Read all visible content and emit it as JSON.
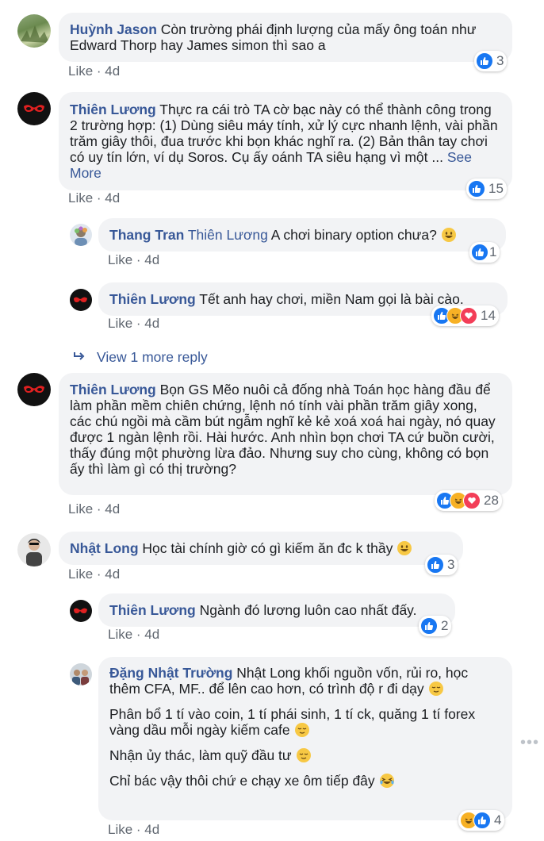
{
  "comments": [
    {
      "name": "Huỳnh Jason",
      "text": "Còn trường phái định lượng của mấy ông toán như Edward Thorp hay James simon thì sao a",
      "like": "Like",
      "time": "4d",
      "count": "3"
    },
    {
      "name": "Thiên Lương",
      "text": "Thực ra cái trò TA cờ bạc này có thể thành công trong 2 trường hợp: (1) Dùng siêu máy tính, xử lý cực nhanh lệnh, vài phần trăm giây thôi, đua trước khi bọn khác nghĩ ra. (2) Bản thân tay chơi có uy tín lớn, ví dụ Soros. Cụ ấy oánh TA siêu hạng vì một ...",
      "see_more": "See More",
      "like": "Like",
      "time": "4d",
      "count": "15"
    },
    {
      "name": "Thang Tran",
      "tag": "Thiên Lương",
      "text": "A chơi binary option chưa?",
      "like": "Like",
      "time": "4d",
      "count": "1"
    },
    {
      "name": "Thiên Lương",
      "text": "Tết anh hay chơi, miền Nam gọi là bài cào.",
      "like": "Like",
      "time": "4d",
      "count": "14"
    },
    {
      "view_more": "View 1 more reply"
    },
    {
      "name": "Thiên Lương",
      "text": "Bọn GS Mẽo nuôi cả đống nhà Toán học hàng đầu để làm phần mềm chiên chứng, lệnh nó tính vài phần trăm giây xong, các chú ngồi mà cầm bút ngẫm nghĩ kẻ kẻ xoá xoá hai ngày, nó quay được 1 ngàn lệnh rồi. Hài hước. Anh nhìn bọn chơi TA cứ buồn cười, thấy đúng một phường lừa đảo. Nhưng suy cho cùng, không có bọn ấy thì làm gì có thị trường?",
      "like": "Like",
      "time": "4d",
      "count": "28"
    },
    {
      "name": "Nhật Long",
      "text": "Học tài chính giờ có gì kiếm ăn đc k thầy",
      "like": "Like",
      "time": "4d",
      "count": "3"
    },
    {
      "name": "Thiên Lương",
      "text": "Ngành đó lương luôn cao nhất đấy.",
      "like": "Like",
      "time": "4d",
      "count": "2"
    },
    {
      "name": "Đặng Nhật Trường",
      "p1": "Nhật Long khối nguồn vốn, rủi ro, học thêm CFA, MF.. để lên cao hơn, có trình độ r đi dạy",
      "p2": "Phân bổ 1 tí vào coin, 1 tí phái sinh, 1 tí ck, quăng 1 tí forex vàng dầu mỗi ngày kiếm cafe",
      "p3": "Nhận ủy thác, làm quỹ đầu tư",
      "p4": "Chỉ bác vậy thôi chứ e chạy xe ôm tiếp đây",
      "like": "Like",
      "time": "4d",
      "count": "4"
    }
  ],
  "colors": {
    "link": "#385898",
    "bubble": "#f2f3f5",
    "meta": "#606770",
    "like_blue": "#1877f2",
    "haha_yellow": "#f7b125",
    "love_red": "#f33e58"
  },
  "icons": [
    "like-icon",
    "haha-icon",
    "love-icon",
    "reply-arrow-icon",
    "more-dots-icon",
    "smile-emoji",
    "relieved-emoji",
    "laughing-tears-emoji"
  ]
}
